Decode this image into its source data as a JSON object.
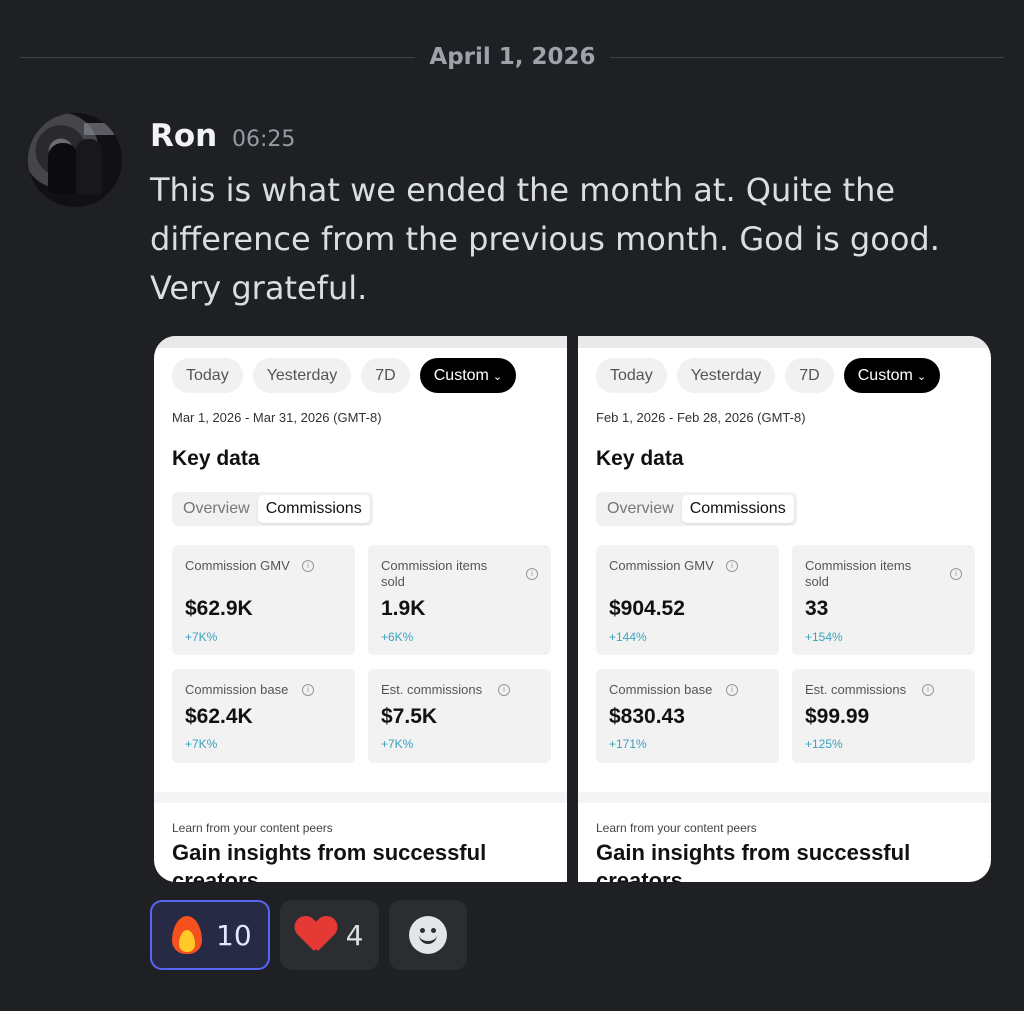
{
  "divider": {
    "date": "April 1, 2026"
  },
  "message": {
    "author": "Ron",
    "time": "06:25",
    "text": "This is what we ended the month at. Quite the difference from the previous month. God is good. Very grateful."
  },
  "attachments": [
    {
      "chips": [
        "Today",
        "Yesterday",
        "7D",
        "Custom"
      ],
      "active_chip": "Custom",
      "range": "Mar 1, 2026 - Mar 31, 2026 (GMT-8)",
      "heading": "Key data",
      "tabs": [
        "Overview",
        "Commissions"
      ],
      "active_tab": "Commissions",
      "metrics": [
        {
          "label": "Commission GMV",
          "value": "$62.9K",
          "delta": "+7K%"
        },
        {
          "label": "Commission items sold",
          "value": "1.9K",
          "delta": "+6K%"
        },
        {
          "label": "Commission base",
          "value": "$62.4K",
          "delta": "+7K%"
        },
        {
          "label": "Est. commissions",
          "value": "$7.5K",
          "delta": "+7K%"
        }
      ],
      "peers_label": "Learn from your content peers",
      "peers_title": "Gain insights from successful creators"
    },
    {
      "chips": [
        "Today",
        "Yesterday",
        "7D",
        "Custom"
      ],
      "active_chip": "Custom",
      "range": "Feb 1, 2026 - Feb 28, 2026 (GMT-8)",
      "heading": "Key data",
      "tabs": [
        "Overview",
        "Commissions"
      ],
      "active_tab": "Commissions",
      "metrics": [
        {
          "label": "Commission GMV",
          "value": "$904.52",
          "delta": "+144%"
        },
        {
          "label": "Commission items sold",
          "value": "33",
          "delta": "+154%"
        },
        {
          "label": "Commission base",
          "value": "$830.43",
          "delta": "+171%"
        },
        {
          "label": "Est. commissions",
          "value": "$99.99",
          "delta": "+125%"
        }
      ],
      "peers_label": "Learn from your content peers",
      "peers_title": "Gain insights from successful creators"
    }
  ],
  "reactions": [
    {
      "emoji": "fire",
      "count": "10",
      "me": true
    },
    {
      "emoji": "heart",
      "count": "4",
      "me": false
    }
  ],
  "colors": {
    "background": "#1f2024",
    "delta": "#3aa2bf",
    "accent": "#5865f2"
  }
}
